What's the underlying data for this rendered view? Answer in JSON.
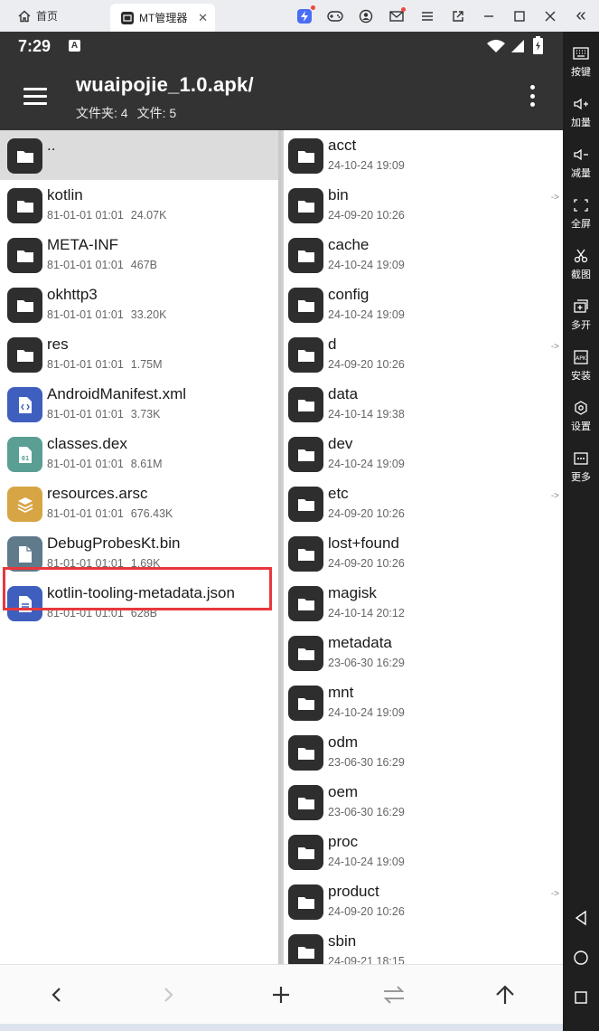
{
  "emulator": {
    "home_tab_label": "首页",
    "app_tab_label": "MT管理器",
    "close_glyph": "✕",
    "collapse_glyph": "«"
  },
  "sidebar": {
    "items": [
      {
        "label": "按键",
        "icon": "keyboard-icon"
      },
      {
        "label": "加量",
        "icon": "volume-up-icon"
      },
      {
        "label": "减量",
        "icon": "volume-down-icon"
      },
      {
        "label": "全屏",
        "icon": "fullscreen-icon"
      },
      {
        "label": "截图",
        "icon": "scissors-icon"
      },
      {
        "label": "多开",
        "icon": "multi-instance-icon"
      },
      {
        "label": "安装",
        "icon": "apk-install-icon"
      },
      {
        "label": "设置",
        "icon": "settings-icon"
      },
      {
        "label": "更多",
        "icon": "more-icon"
      }
    ]
  },
  "status": {
    "time": "7:29",
    "notification_letter": "A"
  },
  "header": {
    "title": "wuaipojie_1.0.apk/",
    "folders_label": "文件夹: 4",
    "files_label": "文件: 5"
  },
  "left_panel": {
    "parent_label": "..",
    "items": [
      {
        "name": "kotlin",
        "date": "81-01-01 01:01",
        "size": "24.07K",
        "type": "folder"
      },
      {
        "name": "META-INF",
        "date": "81-01-01 01:01",
        "size": "467B",
        "type": "folder"
      },
      {
        "name": "okhttp3",
        "date": "81-01-01 01:01",
        "size": "33.20K",
        "type": "folder"
      },
      {
        "name": "res",
        "date": "81-01-01 01:01",
        "size": "1.75M",
        "type": "folder"
      },
      {
        "name": "AndroidManifest.xml",
        "date": "81-01-01 01:01",
        "size": "3.73K",
        "type": "xml"
      },
      {
        "name": "classes.dex",
        "date": "81-01-01 01:01",
        "size": "8.61M",
        "type": "dex"
      },
      {
        "name": "resources.arsc",
        "date": "81-01-01 01:01",
        "size": "676.43K",
        "type": "arsc"
      },
      {
        "name": "DebugProbesKt.bin",
        "date": "81-01-01 01:01",
        "size": "1.69K",
        "type": "bin"
      },
      {
        "name": "kotlin-tooling-metadata.json",
        "date": "81-01-01 01:01",
        "size": "628B",
        "type": "json"
      }
    ]
  },
  "right_panel": {
    "link_marker": "->",
    "items": [
      {
        "name": "acct",
        "date": "24-10-24 19:09",
        "link": false
      },
      {
        "name": "bin",
        "date": "24-09-20 10:26",
        "link": true
      },
      {
        "name": "cache",
        "date": "24-10-24 19:09",
        "link": false
      },
      {
        "name": "config",
        "date": "24-10-24 19:09",
        "link": false
      },
      {
        "name": "d",
        "date": "24-09-20 10:26",
        "link": true
      },
      {
        "name": "data",
        "date": "24-10-14 19:38",
        "link": false
      },
      {
        "name": "dev",
        "date": "24-10-24 19:09",
        "link": false
      },
      {
        "name": "etc",
        "date": "24-09-20 10:26",
        "link": true
      },
      {
        "name": "lost+found",
        "date": "24-09-20 10:26",
        "link": false
      },
      {
        "name": "magisk",
        "date": "24-10-14 20:12",
        "link": false
      },
      {
        "name": "metadata",
        "date": "23-06-30 16:29",
        "link": false
      },
      {
        "name": "mnt",
        "date": "24-10-24 19:09",
        "link": false
      },
      {
        "name": "odm",
        "date": "23-06-30 16:29",
        "link": false
      },
      {
        "name": "oem",
        "date": "23-06-30 16:29",
        "link": false
      },
      {
        "name": "proc",
        "date": "24-10-24 19:09",
        "link": false
      },
      {
        "name": "product",
        "date": "24-09-20 10:26",
        "link": true
      },
      {
        "name": "sbin",
        "date": "24-09-21 18:15",
        "link": false
      }
    ]
  },
  "colors": {
    "app_bar": "#333333",
    "folder_icon": "#2e2e2e",
    "xml_icon": "#3f5fbf",
    "dex_icon": "#5a9e94",
    "arsc_icon": "#d8a545",
    "bin_icon": "#5f7a8a",
    "highlight": "#e8383d"
  }
}
